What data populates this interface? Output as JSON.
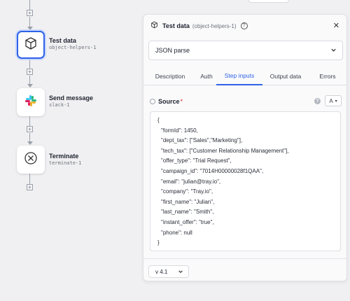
{
  "workflow": {
    "steps": [
      {
        "title": "Test data",
        "subtitle": "object-helpers-1",
        "icon": "box-icon",
        "selected": true
      },
      {
        "title": "Send message",
        "subtitle": "slack-1",
        "icon": "slack-icon",
        "selected": false
      },
      {
        "title": "Terminate",
        "subtitle": "terminate-1",
        "icon": "terminate-x-icon",
        "selected": false
      }
    ]
  },
  "panel": {
    "title": "Test data",
    "subtitle": "(object-helpers-1)",
    "operation": "JSON parse",
    "tabs": [
      "Description",
      "Auth",
      "Step inputs",
      "Output data",
      "Errors"
    ],
    "active_tab": "Step inputs",
    "field": {
      "label": "Source",
      "required_mark": "*",
      "type_button": "A",
      "lines": [
        "{",
        "\"formId\": 1450,",
        "\"dept_tax\": [\"Sales\",\"Marketing\"],",
        "\"tech_tax\": [\"Customer Relationship Management\"],",
        "\"offer_type\": \"Trial Request\",",
        "\"campaign_id\": \"7014H00000028f1QAA\",",
        "\"email\": \"julian@tray.io\",",
        "\"company\": \"Tray.io\",",
        "\"first_name\": \"Julian\",",
        "\"last_name\": \"Smith\",",
        "\"instant_offer\": \"true\",",
        "\"phone\": null",
        "}"
      ]
    },
    "version": "v 4.1"
  },
  "colors": {
    "accent": "#2f62e8",
    "required": "#d93025",
    "canvas": "#f0f0f2"
  }
}
